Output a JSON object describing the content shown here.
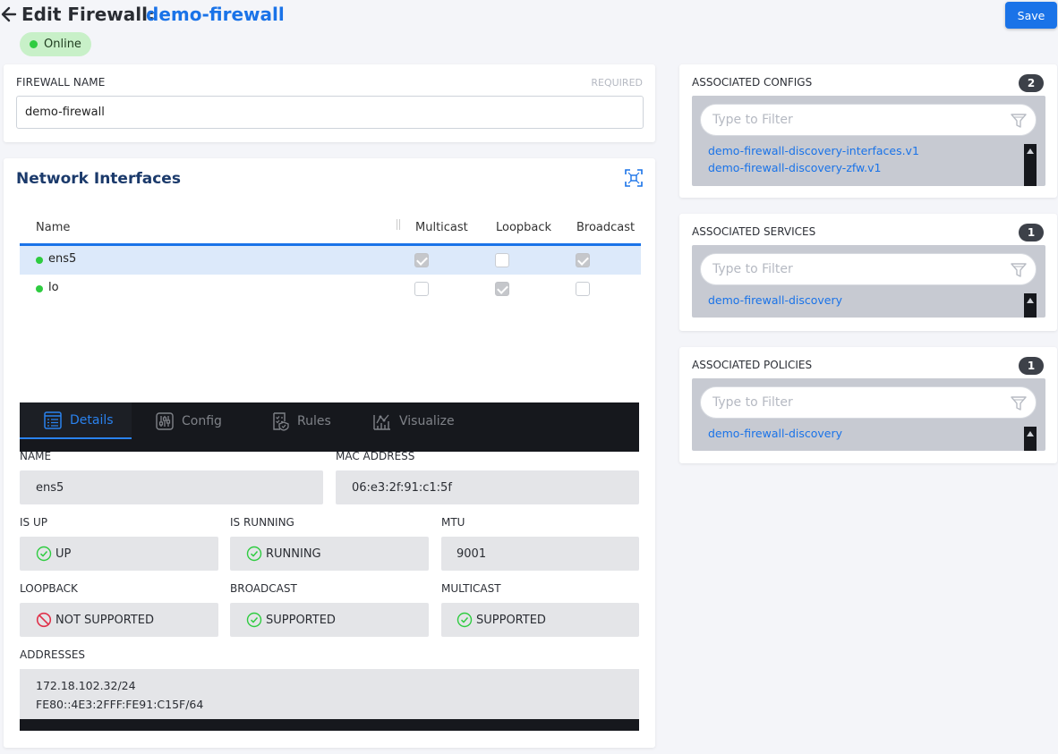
{
  "header": {
    "title_prefix": "Edit Firewall:",
    "firewall_name": "demo-firewall",
    "save_label": "Save",
    "status": "Online"
  },
  "firewall_name_card": {
    "label": "FIREWALL NAME",
    "required": "REQUIRED",
    "value": "demo-firewall"
  },
  "network_interfaces": {
    "title": "Network Interfaces",
    "columns": [
      "Name",
      "Multicast",
      "Loopback",
      "Broadcast"
    ],
    "rows": [
      {
        "name": "ens5",
        "multicast": true,
        "loopback": false,
        "broadcast": true,
        "selected": true
      },
      {
        "name": "lo",
        "multicast": false,
        "loopback": true,
        "broadcast": false,
        "selected": false
      }
    ]
  },
  "tabs": [
    {
      "label": "Details",
      "icon": "list-icon",
      "active": true
    },
    {
      "label": "Config",
      "icon": "sliders-icon",
      "active": false
    },
    {
      "label": "Rules",
      "icon": "rules-icon",
      "active": false
    },
    {
      "label": "Visualize",
      "icon": "chart-icon",
      "active": false
    }
  ],
  "details": {
    "name_label": "NAME",
    "name_value": "ens5",
    "mac_label": "MAC ADDRESS",
    "mac_value": "06:e3:2f:91:c1:5f",
    "isup_label": "IS UP",
    "isup_value": "UP",
    "isrunning_label": "IS RUNNING",
    "isrunning_value": "RUNNING",
    "mtu_label": "MTU",
    "mtu_value": "9001",
    "loopback_label": "LOOPBACK",
    "loopback_value": "NOT SUPPORTED",
    "broadcast_label": "BROADCAST",
    "broadcast_value": "SUPPORTED",
    "multicast_label": "MULTICAST",
    "multicast_value": "SUPPORTED",
    "addresses_label": "ADDRESSES",
    "addresses": [
      "172.18.102.32/24",
      "FE80::4E3:2FFF:FE91:C15F/64"
    ]
  },
  "associated_configs": {
    "title": "ASSOCIATED CONFIGS",
    "count": "2",
    "filter_placeholder": "Type to Filter",
    "items": [
      "demo-firewall-discovery-interfaces.v1",
      "demo-firewall-discovery-zfw.v1"
    ]
  },
  "associated_services": {
    "title": "ASSOCIATED SERVICES",
    "count": "1",
    "filter_placeholder": "Type to Filter",
    "items": [
      "demo-firewall-discovery"
    ]
  },
  "associated_policies": {
    "title": "ASSOCIATED POLICIES",
    "count": "1",
    "filter_placeholder": "Type to Filter",
    "items": [
      "demo-firewall-discovery"
    ]
  },
  "colors": {
    "accent": "#1a73e8",
    "online": "#2ecc40",
    "dark_bar": "#16181d",
    "not_supported": "#e0324b"
  }
}
